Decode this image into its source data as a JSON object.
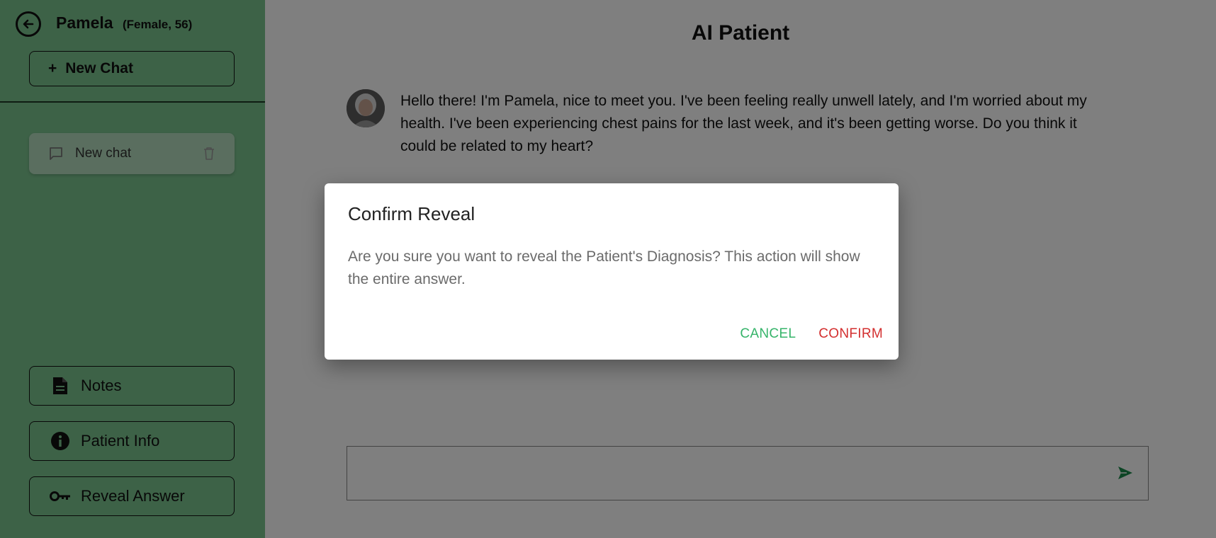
{
  "sidebar": {
    "patient_name": "Pamela",
    "patient_meta": "(Female, 56)",
    "new_chat_label": "New Chat",
    "new_chat_plus": "+",
    "chats": [
      {
        "label": "New chat"
      }
    ],
    "buttons": {
      "notes": "Notes",
      "patient_info": "Patient Info",
      "reveal_answer": "Reveal Answer"
    }
  },
  "main": {
    "title": "AI Patient",
    "messages": [
      {
        "text": "Hello there! I'm Pamela, nice to meet you. I've been feeling really unwell lately, and I'm worried about my health. I've been experiencing chest pains for the last week, and it's been getting worse. Do you think it could be related to my heart?"
      }
    ],
    "input": {
      "value": "",
      "placeholder": ""
    }
  },
  "dialog": {
    "title": "Confirm Reveal",
    "body": "Are you sure you want to reveal the Patient's Diagnosis? This action will show the entire answer.",
    "cancel_label": "CANCEL",
    "confirm_label": "CONFIRM"
  },
  "colors": {
    "sidebar_bg": "#7bc48f",
    "accent_green": "#36b46a",
    "danger_red": "#d32f2f",
    "send_icon": "#1a8a4a"
  },
  "icons": {
    "back": "back-arrow-icon",
    "chat": "chat-bubble-icon",
    "trash": "trash-icon",
    "notes": "document-icon",
    "info": "info-icon",
    "reveal": "key-icon",
    "send": "send-icon"
  }
}
